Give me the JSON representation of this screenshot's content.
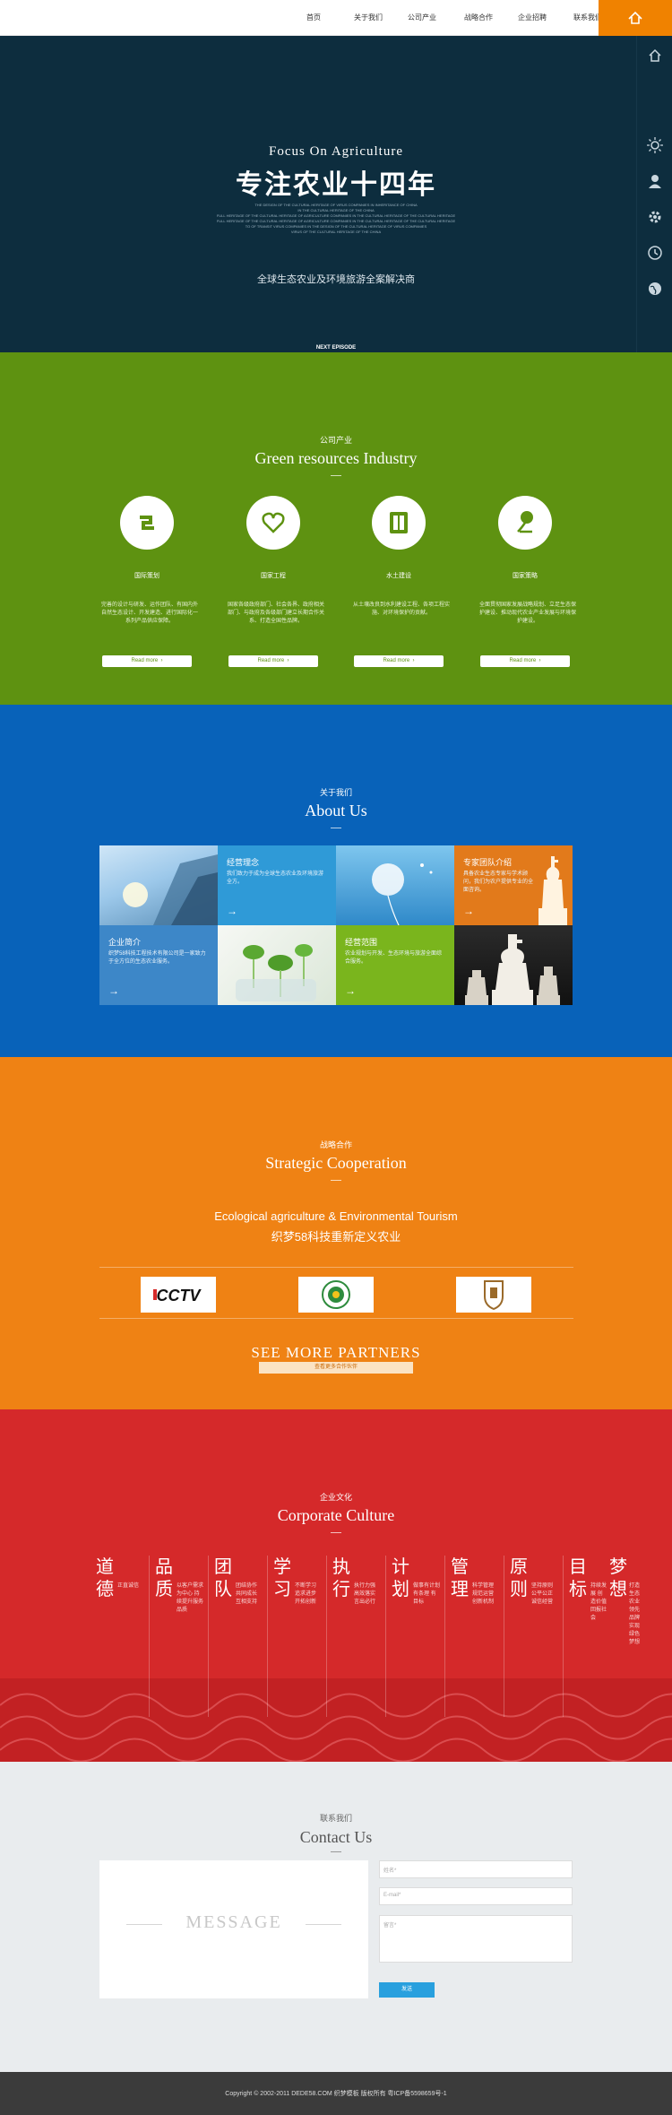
{
  "nav": {
    "items": [
      "首页",
      "关于我们",
      "公司产业",
      "战略合作",
      "企业招聘",
      "联系我们"
    ]
  },
  "hero": {
    "title_en": "Focus On Agriculture",
    "title_cn": "专注农业十四年",
    "paragraph_lines": [
      "THE DESIGN OF THE CULTURAL HERITAGE OF VIRUS COMPANIES IN INHERITANCE OF CHINA",
      "IN THE CULTURAL HERITAGE OF THE CHINA",
      "FULL HERITAGE OF THE CULTURAL HERITAGE OF AGRICULTURE COMPANIES IN THE CULTURAL HERITAGE OF THE CULTURAL HERITAGE",
      "FULL HERITAGE OF THE CULTURAL HERITAGE OF AGRICULTURE COMPANIES IN THE CULTURAL HERITAGE OF THE CULTURAL HERITAGE",
      "TO OF TRANSIT VIRUS COMPANIES IN THE DESIGN OF THE CULTURAL HERITAGE OF VIRUS COMPANIES",
      "VIRUS OF THE CULTURAL HERITAGE OF THE CHINA"
    ],
    "subtitle": "全球生态农业及环境旅游全案解决商",
    "next_label": "NEXT EPISODE",
    "bg_color": "#0d2d3e"
  },
  "toolbar": {
    "icons": [
      "home-icon",
      "sun-icon",
      "user-icon",
      "gear-icon",
      "clock-icon",
      "globe-icon"
    ]
  },
  "industry": {
    "cn": "公司产业",
    "en": "Green resources Industry",
    "bg_color": "#5e9211",
    "cards": [
      {
        "icon": "recycle-icon",
        "title": "国际策划",
        "desc": "完善的设计与研发、运作团队、有国内外自然生态设计、开发建造、进行国际化一系列产品供应保障。",
        "button": "Read more"
      },
      {
        "icon": "heart-leaf-icon",
        "title": "国家工程",
        "desc": "国家各级政府部门、社会各界、政府相关部门、与政府及各级部门建立长期合作关系、打造全国性品牌。",
        "button": "Read more"
      },
      {
        "icon": "door-icon",
        "title": "水土建设",
        "desc": "从土壤改良到水利建设工程、各项工程实施、对环境保护的贡献。",
        "button": "Read more"
      },
      {
        "icon": "plant-icon",
        "title": "国家策略",
        "desc": "全面贯彻国家发展战略规划、立足生态保护建设、推动现代农业产业发展与环境保护建设。",
        "button": "Read more"
      }
    ]
  },
  "about": {
    "cn": "关于我们",
    "en": "About Us",
    "bg_color": "#0862b9",
    "cells": [
      {
        "title": "经营理念",
        "desc": "我们致力于成为全球生态农业及环境旅游全方。"
      },
      {
        "title": "专家团队介绍",
        "desc": "具备农业生态专家与学术顾问，我们为农户提供专业的全面咨询。"
      },
      {
        "title": "企业简介",
        "desc": "织梦58科技工程技术有限公司是一家致力于全方位的生态农业服务。"
      },
      {
        "title": "经营范围",
        "desc": "农业规划与开发、生态环境与旅游全面综合服务。"
      }
    ],
    "arrow": "→"
  },
  "cooperation": {
    "cn": "战略合作",
    "en": "Strategic Cooperation",
    "tagline_en": "Ecological agriculture & Environmental Tourism",
    "tagline_cn": "织梦58科技重新定义农业",
    "logos": [
      "CCTV",
      "Agriculture Ministry",
      "University"
    ],
    "more_label": "SEE MORE PARTNERS",
    "more_button": "查看更多合作伙伴",
    "bg_color": "#ef8214"
  },
  "culture": {
    "cn": "企业文化",
    "en": "Corporate Culture",
    "bg_color": "#d5292a",
    "columns": [
      {
        "big": "道德",
        "small": "正直诚信",
        "tag": ""
      },
      {
        "big": "品质",
        "small": "以客户需求为中心 持续提升服务品质",
        "tag": ""
      },
      {
        "big": "团队",
        "small": "团结协作 共同成长 互相支持",
        "tag": ""
      },
      {
        "big": "学习",
        "small": "不断学习 追求进步 开拓创新",
        "tag": ""
      },
      {
        "big": "执行",
        "small": "执行力强 高效落实 言出必行",
        "tag": ""
      },
      {
        "big": "计划",
        "small": "做事有计划 有条理 有目标",
        "tag": ""
      },
      {
        "big": "管理",
        "small": "科学管理 规范运营 创新机制",
        "tag": ""
      },
      {
        "big": "原则",
        "small": "坚持原则 公平公正 诚信经营",
        "tag": ""
      },
      {
        "big": "目标",
        "small": "持续发展 创造价值 回报社会",
        "tag": ""
      },
      {
        "big": "梦想",
        "small": "打造生态农业领先品牌 实现绿色梦想",
        "tag": ""
      }
    ]
  },
  "contact": {
    "cn": "联系我们",
    "en": "Contact Us",
    "message_label": "MESSAGE",
    "name_placeholder": "姓名*",
    "email_placeholder": "E-mail*",
    "remark_placeholder": "留言*",
    "submit": "发送"
  },
  "footer": {
    "text": "Copyright © 2002-2011 DEDE58.COM 织梦模板 版权所有 粤ICP备5598659号-1"
  }
}
